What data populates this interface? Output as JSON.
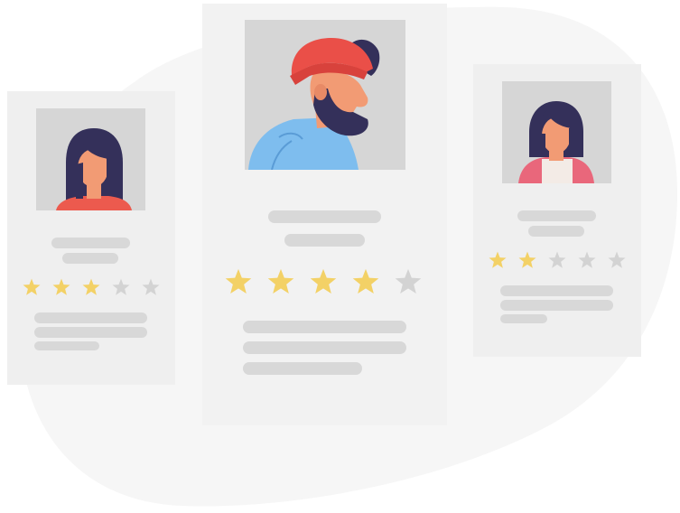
{
  "palette": {
    "background_blob": "#f6f6f6",
    "card": "#efefef",
    "photo_bg": "#d6d6d6",
    "placeholder_bar": "#d8d8d8",
    "star_filled": "#f3d166",
    "star_empty": "#d3d3d3",
    "hair": "#34305a",
    "skin": "#f29b74",
    "beanie": "#ea4f48",
    "hoodie": "#7ebdee",
    "top_red": "#ec5a4e",
    "top_pink": "#e9677b"
  },
  "cards": [
    {
      "id": "left",
      "avatar": "woman-long-hair-icon",
      "rating": 3,
      "max": 5
    },
    {
      "id": "center",
      "avatar": "bearded-man-beanie-icon",
      "rating": 4,
      "max": 5
    },
    {
      "id": "right",
      "avatar": "woman-bob-hair-icon",
      "rating": 2,
      "max": 5
    }
  ]
}
